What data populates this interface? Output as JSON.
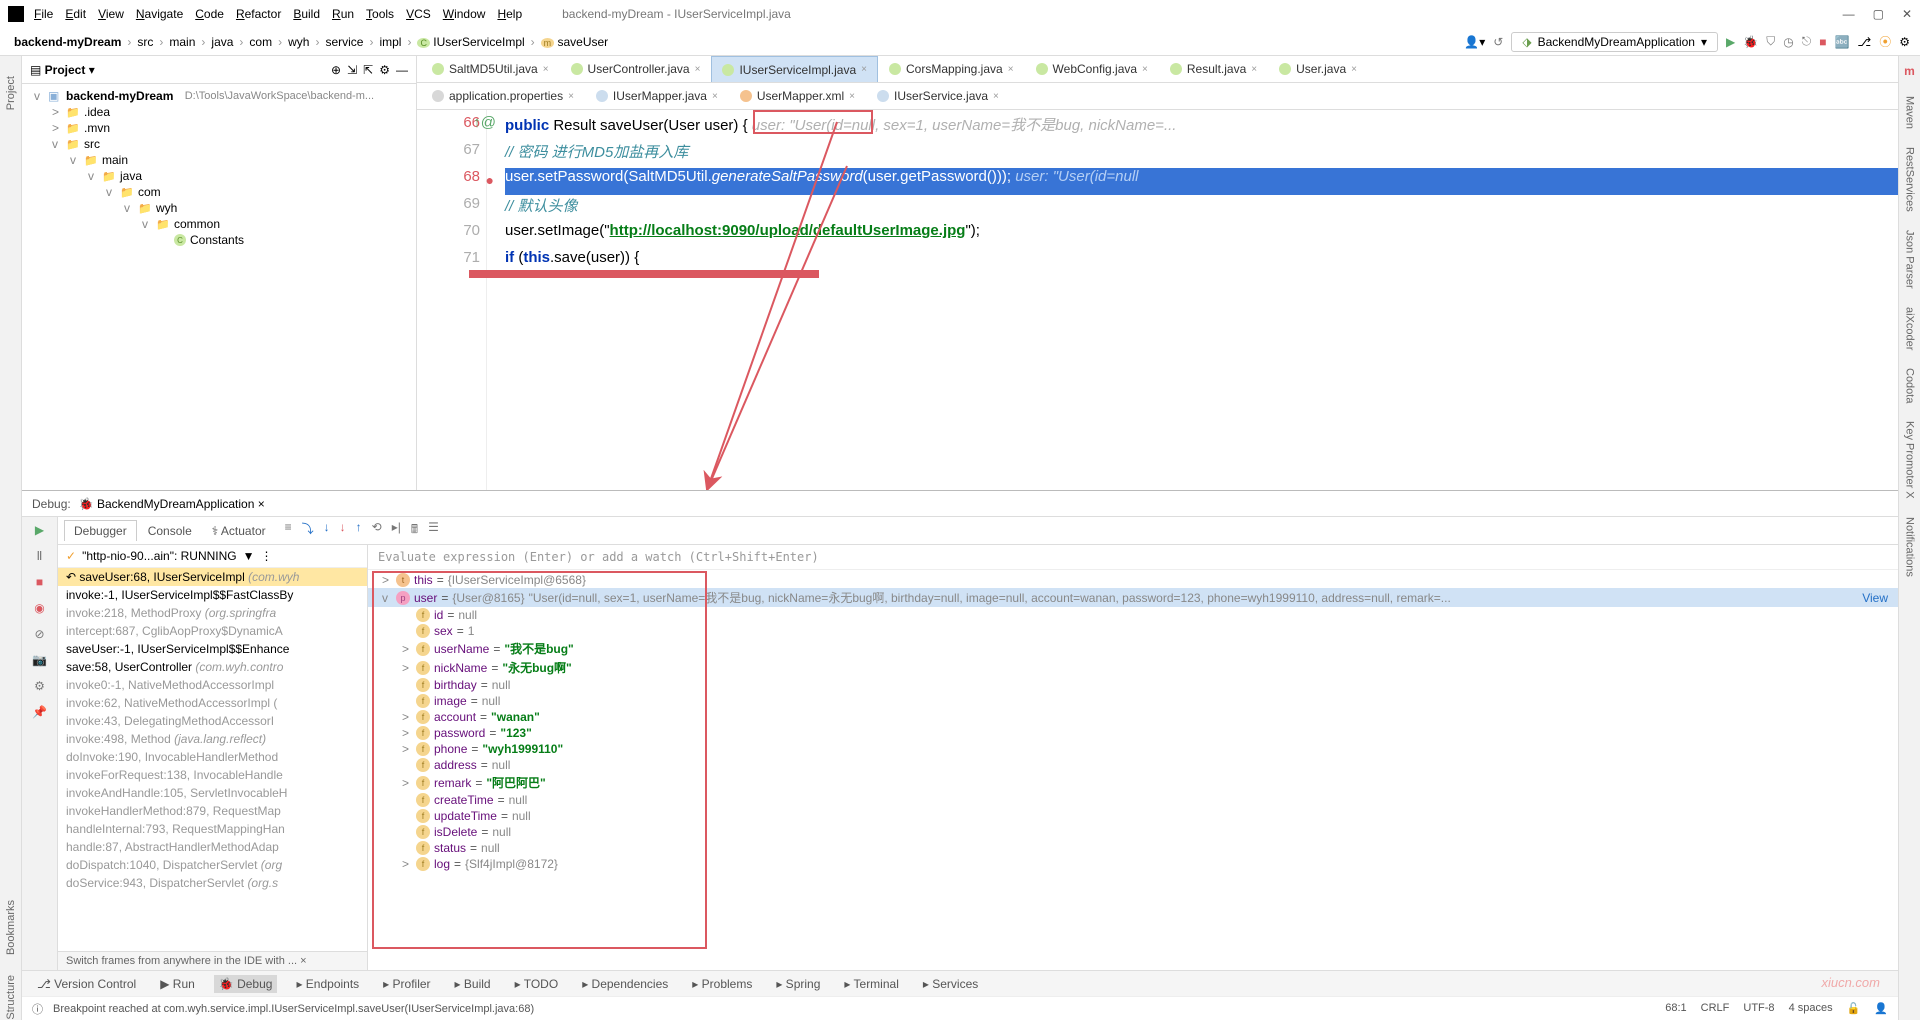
{
  "window": {
    "title": "backend-myDream - IUserServiceImpl.java"
  },
  "menus": [
    "File",
    "Edit",
    "View",
    "Navigate",
    "Code",
    "Refactor",
    "Build",
    "Run",
    "Tools",
    "VCS",
    "Window",
    "Help"
  ],
  "breadcrumbs": [
    "backend-myDream",
    "src",
    "main",
    "java",
    "com",
    "wyh",
    "service",
    "impl",
    "IUserServiceImpl",
    "saveUser"
  ],
  "runcfg": "BackendMyDreamApplication",
  "project": {
    "title": "Project",
    "root": "backend-myDream",
    "rootpath": "D:\\Tools\\JavaWorkSpace\\backend-m...",
    "nodes": [
      {
        "l": 1,
        "a": ">",
        "t": ".idea"
      },
      {
        "l": 1,
        "a": ">",
        "t": ".mvn"
      },
      {
        "l": 1,
        "a": "v",
        "t": "src"
      },
      {
        "l": 2,
        "a": "v",
        "t": "main"
      },
      {
        "l": 3,
        "a": "v",
        "t": "java"
      },
      {
        "l": 4,
        "a": "v",
        "t": "com"
      },
      {
        "l": 5,
        "a": "v",
        "t": "wyh"
      },
      {
        "l": 6,
        "a": "v",
        "t": "common"
      },
      {
        "l": 7,
        "a": "",
        "t": "Constants",
        "cls": true
      }
    ]
  },
  "tabs": [
    {
      "t": "SaltMD5Util.java",
      "i": "c"
    },
    {
      "t": "UserController.java",
      "i": "c"
    },
    {
      "t": "IUserServiceImpl.java",
      "i": "c",
      "active": true
    },
    {
      "t": "CorsMapping.java",
      "i": "c"
    },
    {
      "t": "WebConfig.java",
      "i": "c"
    },
    {
      "t": "Result.java",
      "i": "c"
    },
    {
      "t": "User.java",
      "i": "c"
    }
  ],
  "tabs2": [
    {
      "t": "application.properties",
      "i": "p"
    },
    {
      "t": "IUserMapper.java",
      "i": "i"
    },
    {
      "t": "UserMapper.xml",
      "i": "x"
    },
    {
      "t": "IUserService.java",
      "i": "i"
    }
  ],
  "code": {
    "lines": [
      {
        "n": 66,
        "parts": [
          [
            "pad",
            "        "
          ],
          [
            "kw",
            "public"
          ],
          [
            "sp",
            " "
          ],
          [
            "ty",
            "Result"
          ],
          [
            "sp",
            " "
          ],
          [
            "fn",
            "saveUser"
          ],
          [
            "pm",
            "(User user)"
          ],
          [
            "sp",
            " {    "
          ],
          [
            "hint",
            "user: \"User(id=null, sex=1, userName=我不是bug, nickName=..."
          ]
        ]
      },
      {
        "n": 67,
        "parts": [
          [
            "pad",
            "            "
          ],
          [
            "cmcn",
            "// 密码 进行MD5加盐再入库"
          ]
        ]
      },
      {
        "n": 68,
        "hl": true,
        "bp": true,
        "parts": [
          [
            "pad",
            "            "
          ],
          [
            "txt",
            "user.setPassword(SaltMD5Util."
          ],
          [
            "ital",
            "generateSaltPassword"
          ],
          [
            "txt",
            "(user.getPassword()));    "
          ],
          [
            "hint",
            "user: \"User(id=null"
          ]
        ]
      },
      {
        "n": 69,
        "parts": [
          [
            "pad",
            "            "
          ],
          [
            "cmcn",
            "// 默认头像"
          ]
        ]
      },
      {
        "n": 70,
        "parts": [
          [
            "pad",
            "            "
          ],
          [
            "txt",
            "user.setImage(\""
          ],
          [
            "st",
            "http://localhost:9090/upload/defaultUserImage.jpg"
          ],
          [
            "txt",
            "\");"
          ]
        ]
      },
      {
        "n": 71,
        "parts": [
          [
            "pad",
            "            "
          ],
          [
            "kw",
            "if"
          ],
          [
            "txt",
            " ("
          ],
          [
            "kw",
            "this"
          ],
          [
            "txt",
            ".save(user)) {"
          ]
        ]
      }
    ]
  },
  "debug": {
    "title": "BackendMyDreamApplication",
    "tabs": [
      "Debugger",
      "Console",
      "Actuator"
    ],
    "activeTab": "Debugger",
    "thread": "\"http-nio-90...ain\": RUNNING",
    "frames": [
      {
        "t": "saveUser:68, IUserServiceImpl",
        "g": "(com.wyh",
        "cur": true
      },
      {
        "t": "invoke:-1, IUserServiceImpl$$FastClassBy",
        "act": true
      },
      {
        "t": "invoke:218, MethodProxy",
        "g": "(org.springfra",
        "dim": true
      },
      {
        "t": "intercept:687, CglibAopProxy$DynamicA",
        "dim": true
      },
      {
        "t": "saveUser:-1, IUserServiceImpl$$Enhance",
        "act": true
      },
      {
        "t": "save:58, UserController",
        "g": "(com.wyh.contro",
        "act": true
      },
      {
        "t": "invoke0:-1, NativeMethodAccessorImpl",
        "dim": true
      },
      {
        "t": "invoke:62, NativeMethodAccessorImpl (",
        "dim": true
      },
      {
        "t": "invoke:43, DelegatingMethodAccessorI",
        "dim": true
      },
      {
        "t": "invoke:498, Method",
        "g": "(java.lang.reflect)",
        "dim": true
      },
      {
        "t": "doInvoke:190, InvocableHandlerMethod",
        "dim": true
      },
      {
        "t": "invokeForRequest:138, InvocableHandle",
        "dim": true
      },
      {
        "t": "invokeAndHandle:105, ServletInvocableH",
        "dim": true
      },
      {
        "t": "invokeHandlerMethod:879, RequestMap",
        "dim": true
      },
      {
        "t": "handleInternal:793, RequestMappingHan",
        "dim": true
      },
      {
        "t": "handle:87, AbstractHandlerMethodAdap",
        "dim": true
      },
      {
        "t": "doDispatch:1040, DispatcherServlet",
        "g": "(org",
        "dim": true
      },
      {
        "t": "doService:943, DispatcherServlet",
        "g": "(org.s",
        "dim": true
      }
    ],
    "framesTip": "Switch frames from anywhere in the IDE with ...",
    "evalHint": "Evaluate expression (Enter) or add a watch (Ctrl+Shift+Enter)",
    "vars": [
      {
        "l": 0,
        "a": ">",
        "b": "t",
        "nm": "this",
        "eq": " = ",
        "val": "{IUserServiceImpl@6568}",
        "vt": "g"
      },
      {
        "l": 0,
        "a": "v",
        "b": "p",
        "nm": "user",
        "eq": " = ",
        "val": "{User@8165}",
        "vt": "g",
        "extra": " \"User(id=null, sex=1, userName=我不是bug, nickName=永无bug啊, birthday=null, image=null, account=wanan, password=123, phone=wyh1999110, address=null, remark=...",
        "sel": true,
        "view": true
      },
      {
        "l": 1,
        "a": "",
        "b": "f",
        "nm": "id",
        "eq": " = ",
        "val": "null",
        "vt": "g"
      },
      {
        "l": 1,
        "a": "",
        "b": "f",
        "nm": "sex",
        "eq": " = ",
        "val": "1",
        "vt": "g"
      },
      {
        "l": 1,
        "a": ">",
        "b": "f",
        "nm": "userName",
        "eq": " = ",
        "val": "\"我不是bug\"",
        "vt": "s"
      },
      {
        "l": 1,
        "a": ">",
        "b": "f",
        "nm": "nickName",
        "eq": " = ",
        "val": "\"永无bug啊\"",
        "vt": "s"
      },
      {
        "l": 1,
        "a": "",
        "b": "f",
        "nm": "birthday",
        "eq": " = ",
        "val": "null",
        "vt": "g"
      },
      {
        "l": 1,
        "a": "",
        "b": "f",
        "nm": "image",
        "eq": " = ",
        "val": "null",
        "vt": "g"
      },
      {
        "l": 1,
        "a": ">",
        "b": "f",
        "nm": "account",
        "eq": " = ",
        "val": "\"wanan\"",
        "vt": "s"
      },
      {
        "l": 1,
        "a": ">",
        "b": "f",
        "nm": "password",
        "eq": " = ",
        "val": "\"123\"",
        "vt": "s"
      },
      {
        "l": 1,
        "a": ">",
        "b": "f",
        "nm": "phone",
        "eq": " = ",
        "val": "\"wyh1999110\"",
        "vt": "s"
      },
      {
        "l": 1,
        "a": "",
        "b": "f",
        "nm": "address",
        "eq": " = ",
        "val": "null",
        "vt": "g"
      },
      {
        "l": 1,
        "a": ">",
        "b": "f",
        "nm": "remark",
        "eq": " = ",
        "val": "\"阿巴阿巴\"",
        "vt": "s"
      },
      {
        "l": 1,
        "a": "",
        "b": "f",
        "nm": "createTime",
        "eq": " = ",
        "val": "null",
        "vt": "g"
      },
      {
        "l": 1,
        "a": "",
        "b": "f",
        "nm": "updateTime",
        "eq": " = ",
        "val": "null",
        "vt": "g"
      },
      {
        "l": 1,
        "a": "",
        "b": "f",
        "nm": "isDelete",
        "eq": " = ",
        "val": "null",
        "vt": "g"
      },
      {
        "l": 1,
        "a": "",
        "b": "f",
        "nm": "status",
        "eq": " = ",
        "val": "null",
        "vt": "g"
      },
      {
        "l": 1,
        "a": ">",
        "b": "f",
        "nm": "log",
        "eq": " = ",
        "val": "{Slf4jImpl@8172}",
        "vt": "g"
      }
    ]
  },
  "bottombar": [
    "Version Control",
    "Run",
    "Debug",
    "Endpoints",
    "Profiler",
    "Build",
    "TODO",
    "Dependencies",
    "Problems",
    "Spring",
    "Terminal",
    "Services"
  ],
  "status": {
    "msg": "Breakpoint reached at com.wyh.service.impl.IUserServiceImpl.saveUser(IUserServiceImpl.java:68)",
    "pos": "68:1",
    "crlf": "CRLF",
    "enc": "UTF-8",
    "ind": "4 spaces"
  },
  "sidebars": {
    "left": [
      "Project",
      "Bookmarks",
      "Structure"
    ],
    "right": [
      "Maven",
      "RestServices",
      "Json Parser",
      "aiXcoder",
      "Codota",
      "Key Promoter X",
      "Notifications"
    ]
  },
  "watermark": "xiucn.com"
}
